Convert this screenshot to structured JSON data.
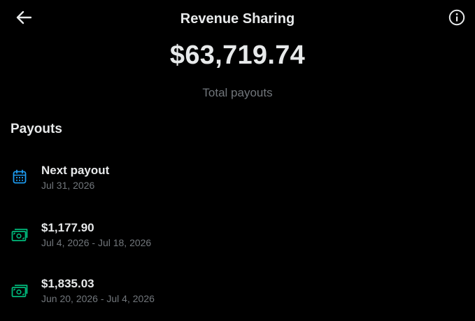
{
  "header": {
    "title": "Revenue Sharing",
    "back_icon": "arrow-left-icon",
    "info_icon": "info-circle-icon"
  },
  "summary": {
    "total_amount": "$63,719.74",
    "total_label": "Total payouts"
  },
  "payouts": {
    "heading": "Payouts",
    "items": [
      {
        "icon": "calendar-icon",
        "icon_color": "#1d9bf0",
        "title": "Next payout",
        "subtitle": "Jul 31, 2026"
      },
      {
        "icon": "cash-icon",
        "icon_color": "#00ba7c",
        "title": "$1,177.90",
        "subtitle": "Jul 4, 2026 - Jul 18, 2026"
      },
      {
        "icon": "cash-icon",
        "icon_color": "#00ba7c",
        "title": "$1,835.03",
        "subtitle": "Jun 20, 2026 - Jul 4, 2026"
      }
    ]
  },
  "colors": {
    "background": "#000000",
    "primary_text": "#e7e9ea",
    "secondary_text": "#71767b",
    "calendar_accent": "#1d9bf0",
    "cash_accent": "#00ba7c"
  }
}
